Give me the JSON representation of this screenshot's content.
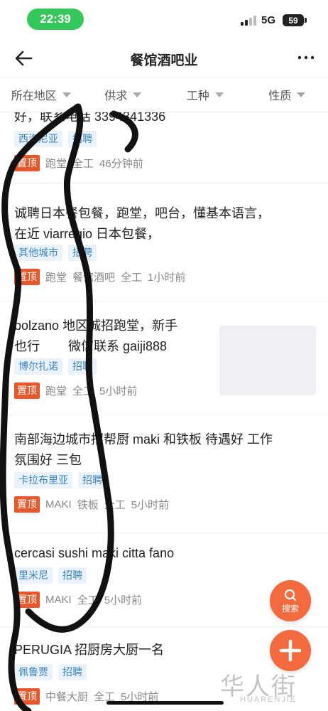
{
  "status_bar": {
    "time": "22:39",
    "network": "5G",
    "battery": "59"
  },
  "nav": {
    "title": "餐馆酒吧业"
  },
  "filters": [
    {
      "label": "所在地区"
    },
    {
      "label": "供求"
    },
    {
      "label": "工种"
    },
    {
      "label": "性质"
    }
  ],
  "listings": [
    {
      "title_lines": [
        "好，联系电话 3394341336"
      ],
      "tags": [
        "西洛尼亚",
        "招聘"
      ],
      "badge": "置顶",
      "meta": [
        "跑堂",
        "全工",
        "46分钟前"
      ]
    },
    {
      "title_lines": [
        "诚聘日本餐包餐，跑堂，吧台，懂基本语言，",
        "在近 viarregio 日本包餐，"
      ],
      "tags": [
        "其他城市",
        "招聘"
      ],
      "badge": "置顶",
      "meta": [
        "跑堂",
        "餐馆酒吧",
        "全工",
        "1小时前"
      ]
    },
    {
      "title_lines": [
        "bolzano 地区诚招跑堂，新手",
        "也行        微信联系 gaiji888"
      ],
      "tags": [
        "博尔扎诺",
        "招聘"
      ],
      "badge": "置顶",
      "meta": [
        "跑堂",
        "全工",
        "5小时前"
      ]
    },
    {
      "title_lines": [
        "南部海边城市招帮厨 maki 和铁板 待遇好 工作",
        "氛围好 三包"
      ],
      "tags": [
        "卡拉布里亚",
        "招聘"
      ],
      "badge": "置顶",
      "meta": [
        "MAKI",
        "铁板",
        "全工",
        "5小时前"
      ]
    },
    {
      "title_lines": [
        "cercasi sushi maki citta fano"
      ],
      "tags": [
        "里米尼",
        "招聘"
      ],
      "badge": "置顶",
      "meta": [
        "MAKI",
        "全工",
        "5小时前"
      ]
    },
    {
      "title_lines": [
        "PERUGIA 招厨房大厨一名"
      ],
      "tags": [
        "佩鲁贾",
        "招聘"
      ],
      "badge": "置顶",
      "meta": [
        "中餐大厨",
        "全工",
        "5小时前"
      ]
    }
  ],
  "fab": {
    "search_label": "搜索"
  },
  "watermark": {
    "text": "华人街",
    "sub": "HUARENJIE"
  },
  "colors": {
    "accent": "#f26a3d",
    "tag_bg": "#eaf3fb",
    "tag_text": "#3b83c4",
    "badge": "#e8572a",
    "status_pill": "#34c759"
  }
}
